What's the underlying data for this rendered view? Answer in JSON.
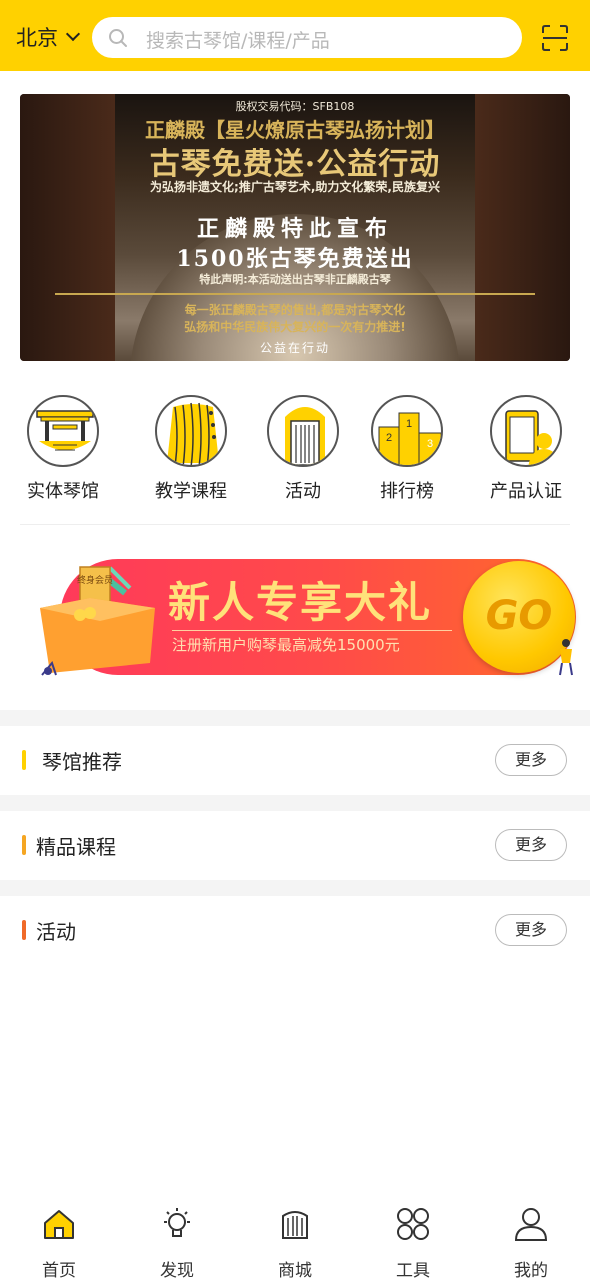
{
  "header": {
    "city": "北京",
    "search_placeholder": "搜索古琴馆/课程/产品",
    "accent_color": "#FFD100"
  },
  "banner": {
    "stock_code": "股权交易代码：SFB108",
    "line1": "正麟殿【星火燎原古琴弘扬计划】",
    "line2": "古琴免费送·公益行动",
    "line3": "为弘扬非遗文化;推广古琴艺术,助力文化繁荣,民族复兴",
    "line4": "正麟殿特此宣布",
    "line5": "1500张古琴免费送出",
    "line6": "特此声明:本活动送出古琴非正麟殿古琴",
    "line7": "每一张正麟殿古琴的售出,都是对古琴文化",
    "line8": "弘扬和中华民族伟大复兴的一次有力推进!",
    "line9": "公益在行动"
  },
  "categories": [
    {
      "label": "实体琴馆",
      "icon": "pavilion-icon"
    },
    {
      "label": "教学课程",
      "icon": "guqin-strings-icon"
    },
    {
      "label": "活动",
      "icon": "event-icon"
    },
    {
      "label": "排行榜",
      "icon": "podium-icon"
    },
    {
      "label": "产品认证",
      "icon": "certificate-icon"
    }
  ],
  "promo": {
    "title": "新人专享大礼",
    "subtitle": "注册新用户购琴最高减免15000元",
    "go": "GO",
    "box_label": "终身会员"
  },
  "sections": [
    {
      "title": "琴馆推荐",
      "more": "更多",
      "bar_color": "#FFD100"
    },
    {
      "title": "精品课程",
      "more": "更多",
      "bar_color": "#F5A623"
    },
    {
      "title": "活动",
      "more": "更多",
      "bar_color": "#F06A28"
    }
  ],
  "tabs": [
    {
      "label": "首页",
      "icon": "home-icon"
    },
    {
      "label": "发现",
      "icon": "lightbulb-icon"
    },
    {
      "label": "商城",
      "icon": "shop-icon"
    },
    {
      "label": "工具",
      "icon": "tools-icon"
    },
    {
      "label": "我的",
      "icon": "user-icon"
    }
  ]
}
